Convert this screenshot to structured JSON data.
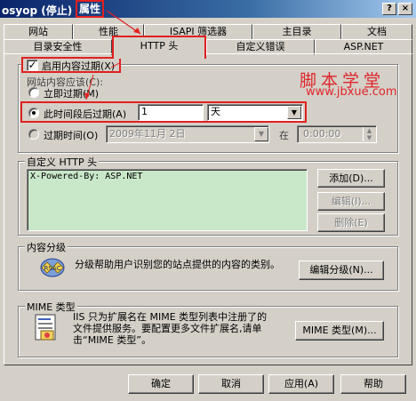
{
  "window": {
    "title_prefix": "osyop (停止)",
    "title_suffix": "属性",
    "help_btn": "?",
    "close_btn": "×"
  },
  "tabs_row1": [
    "网站",
    "性能",
    "ISAPI 筛选器",
    "主目录",
    "文档"
  ],
  "tabs_row2": [
    "目录安全性",
    "HTTP 头",
    "自定义错误",
    "ASP.NET"
  ],
  "watermark": {
    "chinese": "脚本学堂",
    "url": "www.jbxue.com"
  },
  "expiry": {
    "enable_label": "启用内容过期(X)",
    "enable_checked": true,
    "section_label": "网站内容应该(C):",
    "immediate_label": "立即过期(M)",
    "after_label": "此时间段后过期(A)",
    "after_value": "1",
    "after_unit": "天",
    "on_label": "过期时间(O)",
    "on_date": "2009年11月 2日",
    "at_label": "在",
    "on_time": "0:00:00",
    "selected": "after"
  },
  "custom_headers": {
    "label": "自定义 HTTP 头",
    "items": [
      "X-Powered-By: ASP.NET"
    ],
    "add_btn": "添加(D)...",
    "edit_btn": "编辑(I)...",
    "remove_btn": "删除(E)"
  },
  "rating": {
    "label": "内容分级",
    "text": "分级帮助用户识别您的站点提供的内容的类别。",
    "edit_btn": "编辑分级(N)..."
  },
  "mime": {
    "label": "MIME 类型",
    "text": "IIS 只为扩展名在 MIME 类型列表中注册了的文件提供服务。要配置更多文件扩展名,请单击“MIME 类型”。",
    "btn": "MIME 类型(M)..."
  },
  "footer": {
    "ok": "确定",
    "cancel": "取消",
    "apply": "应用(A)",
    "help": "帮助"
  }
}
